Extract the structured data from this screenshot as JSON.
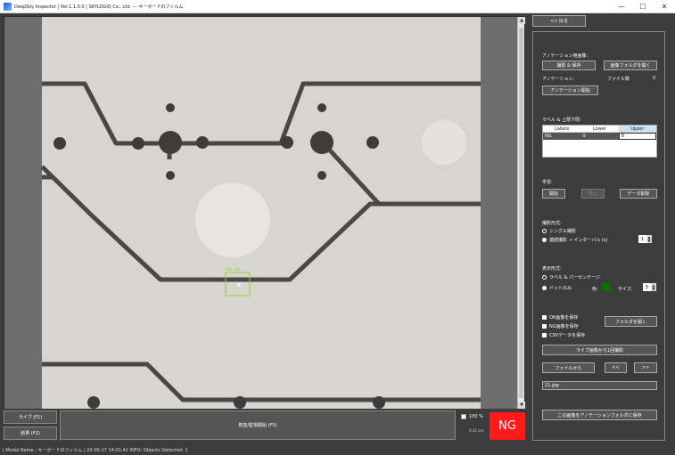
{
  "window": {
    "title": "DeepSky Inspector | Ver.1.1.0.0 | SKYLOGIQ Co., Ltd. --- キーボードのフィルム",
    "minimize": "—",
    "maximize": "☐",
    "close": "✕"
  },
  "bottom": {
    "live_button": "ライブ (F1)",
    "result_button": "結果 (F2)",
    "inspect_button": "検査/監視開始 (F5)",
    "threshold_label": "100 %",
    "time_label": "0.42 sec",
    "ng_label": "NG"
  },
  "statusbar": {
    "text": "| Model Name : キーボードのフィルム |    20-06-17 14:01:42    INFO:   Objects Detected: 1"
  },
  "right_panel": {
    "back_button": "<< 戻る",
    "annotation_images_heading": "アノテーション用画像:",
    "shoot_save_button": "撮影 & 保存",
    "open_image_folder_button": "画像フォルダを開く",
    "annotation_label": "アノテーション:",
    "file_count_label": "ファイル数",
    "file_count_value": "0",
    "start_annotation_button": "アノテーション開始",
    "label_bounds_heading": "ラベル & 上限下限:",
    "table": {
      "headers": [
        "Labels",
        "Lower",
        "Upper"
      ],
      "rows": [
        [
          "NG",
          "0",
          "0"
        ]
      ]
    },
    "learning_heading": "学習:",
    "start_button": "開始",
    "stop_button": "停止",
    "delete_data_button": "データ削除",
    "capture_mode_heading": "撮影形式:",
    "single_capture": "シングル撮影",
    "continuous_capture": "連続撮影 → インターバル (s)",
    "interval_value": "1",
    "display_mode_heading": "表示形式:",
    "label_percent": "ラベル & パーセンテージ",
    "dot_only": "ドットのみ",
    "color_label": "色:",
    "size_label": "サイズ:",
    "size_value": "5",
    "dot_color": "#0a6e0a",
    "save_ok": "OK画像を保存",
    "save_ng": "NG画像を保存",
    "save_csv": "CSVデータを保存",
    "open_folder_button": "フォルダを開く",
    "capture_from_live_button": "ライブ画像から1回撮影",
    "from_file_button": "ファイルから",
    "prev_button": "<<",
    "next_button": ">>",
    "file_name": "11.jpg",
    "save_to_annotation_button": "この画像をアノテーションフォルダに保存"
  },
  "viewer": {
    "detection_label": "NG: 0.9"
  }
}
